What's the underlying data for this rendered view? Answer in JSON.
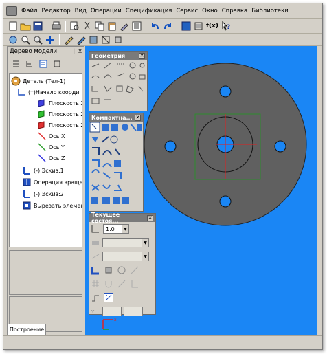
{
  "menu": {
    "items": [
      "Файл",
      "Редактор",
      "Вид",
      "Операции",
      "Спецификация",
      "Сервис",
      "Окно",
      "Справка",
      "Библиотеки"
    ]
  },
  "toolbar": {
    "zoom_fx": "f(x)"
  },
  "model_tree": {
    "title": "Дерево модели",
    "pin": "❘ x",
    "items": [
      {
        "label": "Деталь (Тел-1)",
        "icon": "part-icon"
      },
      {
        "label": "(т)Начало коорди",
        "icon": "origin-icon"
      },
      {
        "label": "Плоскость XY",
        "icon": "plane-xy-icon"
      },
      {
        "label": "Плоскость ZX",
        "icon": "plane-zx-icon"
      },
      {
        "label": "Плоскость ZY",
        "icon": "plane-zy-icon"
      },
      {
        "label": "Ось X",
        "icon": "axis-x-icon"
      },
      {
        "label": "Ось Y",
        "icon": "axis-y-icon"
      },
      {
        "label": "Ось Z",
        "icon": "axis-z-icon"
      },
      {
        "label": "(-) Эскиз:1",
        "icon": "sketch-icon"
      },
      {
        "label": "Операция враще",
        "icon": "revolve-icon"
      },
      {
        "label": "(-) Эскиз:2",
        "icon": "sketch-icon"
      },
      {
        "label": "Вырезать элемен",
        "icon": "cut-icon"
      }
    ],
    "tab_label": "Построение"
  },
  "geometry_panel": {
    "title": "Геометрия"
  },
  "compact_panel": {
    "title": "Компактна..."
  },
  "current_state_panel": {
    "title": "Текущее состоя...",
    "step_value": "1.0"
  },
  "colors": {
    "canvas": "#1a86f5",
    "part": "#606060",
    "outline": "#2e8b2e",
    "axis_red": "#e02020"
  }
}
